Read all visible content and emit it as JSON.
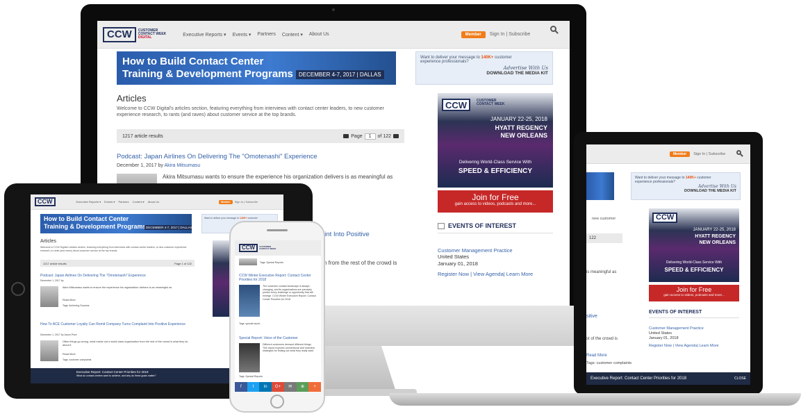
{
  "site": {
    "logo": "CCW",
    "logo_sub": [
      "CUSTOMER",
      "CONTACT WEEK"
    ],
    "logo_digital": "DIGITAL",
    "nav": [
      "Executive Reports ▾",
      "Events ▾",
      "Partners",
      "Content ▾",
      "About Us"
    ],
    "member": "Member",
    "signin": "Sign In | Subscribe"
  },
  "banner": {
    "title_line1": "How to Build Contact Center",
    "title_line2": "Training & Development Programs",
    "date": "DECEMBER 4-7, 2017 | DALLAS"
  },
  "ad_top": {
    "line1_pre": "Want to deliver your message to ",
    "line1_hl": "140K+",
    "line1_post": " customer",
    "line2": "experience professionals?",
    "script": "Advertise With Us",
    "cta": "DOWNLOAD THE MEDIA KIT"
  },
  "ccw_ad": {
    "dates": "JANUARY 22-25, 2018",
    "venue1": "HYATT REGENCY",
    "venue2": "NEW ORLEANS",
    "deliver": "Delivering World-Class Service With",
    "speed": "SPEED & EFFICIENCY"
  },
  "join": {
    "title": "Join for Free",
    "sub": "gain access to videos, podcasts and more..."
  },
  "events": {
    "heading": "EVENTS OF INTEREST",
    "name": "Customer Management Practice",
    "country": "United States",
    "date": "January 01, 2018",
    "links": "Register Now | View Agenda| Learn More"
  },
  "articles": {
    "heading": "Articles",
    "intro": "Welcome to CCW Digital's articles section, featuring everything from interviews with contact center leaders, to new customer experience research, to rants (and raves) about customer service at the top brands.",
    "results": "1217 article results",
    "page_label": "Page",
    "page_num": "1",
    "page_of": "of 122"
  },
  "posts": [
    {
      "title": "Podcast: Japan Airlines On Delivering The \"Omotenashi\" Experience",
      "date": "December 1, 2017 by ",
      "author": "Akira Mitsumasu",
      "body": "Akira Mitsumasu wants to ensure the experience his organization delivers is as meaningful as",
      "read_more": "Read More",
      "tags": "Tags: Achieving Success"
    },
    {
      "title": "How To ACE Customer Loyalty Can Remit Company Turns Complaint Into Positive Experience",
      "date": "December 1, 2017 by Jason Price",
      "body": "Often things go wrong, what marks out a world-class organization from the rest of the crowd is what they do about it",
      "read_more": "Read More",
      "tags": "Tags: customer complaints"
    }
  ],
  "desktop_fragments": {
    "title_tail": "aint Into Positive",
    "body_tail": "h from the rest of the crowd is"
  },
  "laptop_fragments": {
    "bc": "new customer",
    "pager": "122",
    "meaningful": "is meaningful as",
    "sitive": "sitive",
    "crowd": "st of the crowd is",
    "read_more": "Read More",
    "tags": "Tags: customer complaints",
    "exec": "Executive Report: Contact Center Priorities for 2018",
    "close": "CLOSE"
  },
  "tablet_footer": {
    "exec": "Executive Report: Contact Center Priorities for 2018",
    "sub": "What do contact centers want to achieve, and why do these goals matter?"
  },
  "phone": {
    "tags_top": "Tags: Special Reports",
    "post1_title": "CCW Winter Executive Report: Contact Center Priorities for 2018",
    "post1_body": "The customer contact landscape is always changing, and its organizations are precisely predict every challenge or opportunity that will emerge. CCW Winter Executive Report: Contact Center Priorities for 2018",
    "post1_tags": "Tags: special report",
    "post2_title": "Special Report: Voice of the Customer",
    "post2_body": "Different customers demand different things. This report explores conventional and inventive strategies for finding out what they really want.",
    "post2_tags": "Tags: Special Reports",
    "share": [
      "f",
      "t",
      "in",
      "G+",
      "✉",
      "⊕",
      "+"
    ]
  },
  "colors": {
    "accent": "#3461a8",
    "brand_navy": "#1f2d5a",
    "member_orange": "#f07d1a",
    "join_red": "#c62828"
  }
}
